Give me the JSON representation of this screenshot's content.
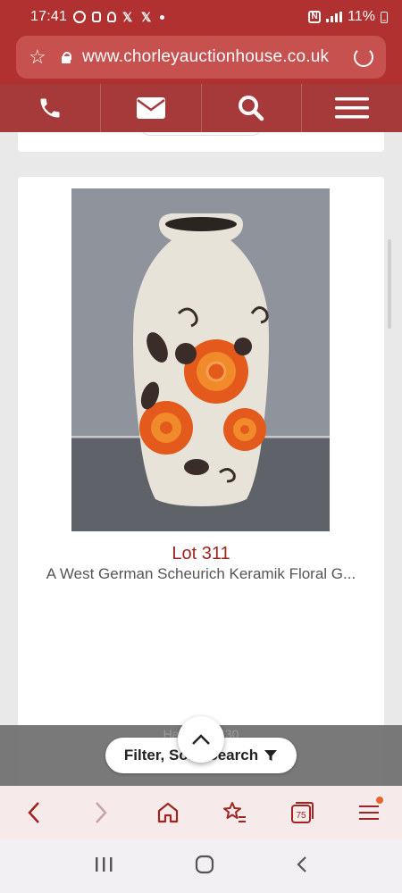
{
  "status_bar": {
    "time": "17:41",
    "battery": "11%",
    "nfc_label": "N",
    "x_glyph": "𝕏"
  },
  "browser": {
    "url": "www.chorleyauctionhouse.co.uk",
    "tab_count": "75",
    "icons": [
      "star-icon",
      "lock-icon",
      "reload-icon",
      "back-arrow-icon",
      "forward-arrow-icon",
      "home-icon",
      "bookmarks-icon",
      "tabs-icon",
      "menu-icon"
    ]
  },
  "site_nav": {
    "icons": [
      "phone-icon",
      "email-icon",
      "search-icon",
      "hamburger-menu-icon"
    ],
    "colors": {
      "bar": "#a63a3a",
      "top": "#b0312f"
    }
  },
  "lot": {
    "number": "Lot 311",
    "title": "A West German Scheurich Keramik Floral G...",
    "image_alt": "ceramic floor vase with orange flower decoration"
  },
  "filter_bar": {
    "label": "Filter, Sort, Search",
    "obscured_text": "Hammer: £30"
  },
  "colors": {
    "accent": "#9e2521",
    "brand": "#b0312f"
  }
}
